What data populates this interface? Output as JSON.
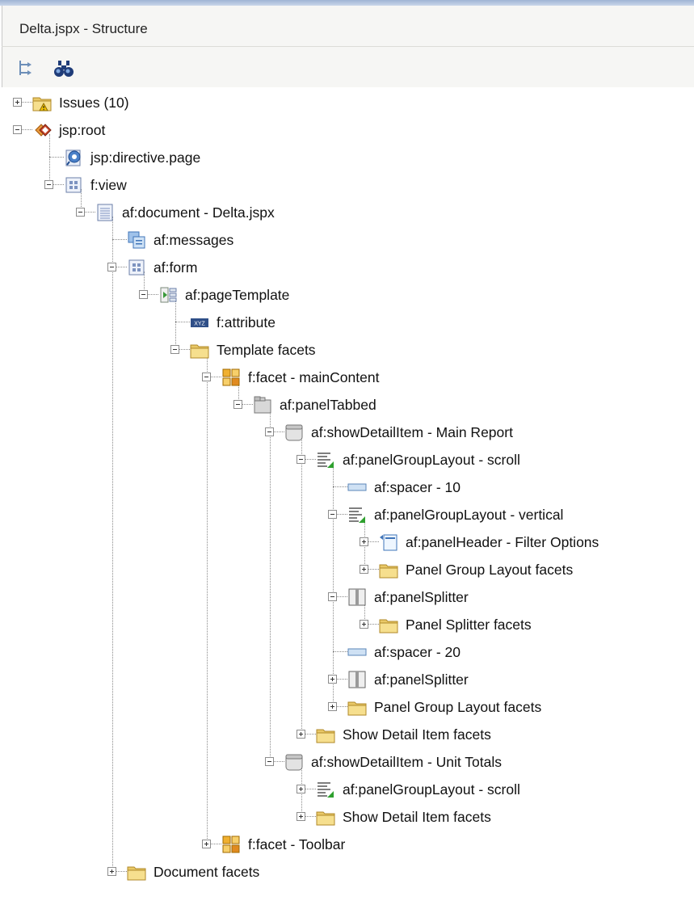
{
  "panel_title": "Delta.jspx - Structure",
  "toolbar": [
    {
      "name": "tree-sync-icon"
    },
    {
      "name": "binoculars-icon"
    }
  ],
  "tree": [
    {
      "level": 0,
      "label": "Issues (10)",
      "icon": "folder-warning",
      "expander": "plus"
    },
    {
      "level": 0,
      "label": "jsp:root",
      "icon": "jsp-root",
      "expander": "minus"
    },
    {
      "level": 1,
      "label": "jsp:directive.page",
      "icon": "directive",
      "expander": "none"
    },
    {
      "level": 1,
      "label": "f:view",
      "icon": "grid-box",
      "expander": "minus"
    },
    {
      "level": 2,
      "label": "af:document - Delta.jspx",
      "icon": "document",
      "expander": "minus"
    },
    {
      "level": 3,
      "label": "af:messages",
      "icon": "messages",
      "expander": "none"
    },
    {
      "level": 3,
      "label": "af:form",
      "icon": "grid-box",
      "expander": "minus"
    },
    {
      "level": 4,
      "label": "af:pageTemplate",
      "icon": "page-template",
      "expander": "minus"
    },
    {
      "level": 5,
      "label": "f:attribute",
      "icon": "attribute",
      "expander": "none"
    },
    {
      "level": 5,
      "label": "Template facets",
      "icon": "folder",
      "expander": "minus"
    },
    {
      "level": 6,
      "label": "f:facet - mainContent",
      "icon": "facet",
      "expander": "minus"
    },
    {
      "level": 7,
      "label": "af:panelTabbed",
      "icon": "panel-tabbed",
      "expander": "minus"
    },
    {
      "level": 8,
      "label": "af:showDetailItem - Main Report",
      "icon": "show-detail",
      "expander": "minus"
    },
    {
      "level": 9,
      "label": "af:panelGroupLayout - scroll",
      "icon": "group-layout",
      "expander": "minus"
    },
    {
      "level": 10,
      "label": "af:spacer - 10",
      "icon": "spacer",
      "expander": "none"
    },
    {
      "level": 10,
      "label": "af:panelGroupLayout - vertical",
      "icon": "group-layout",
      "expander": "minus"
    },
    {
      "level": 11,
      "label": "af:panelHeader - Filter Options",
      "icon": "panel-header",
      "expander": "plus"
    },
    {
      "level": 11,
      "label": "Panel Group Layout facets",
      "icon": "folder",
      "expander": "plus"
    },
    {
      "level": 10,
      "label": "af:panelSplitter",
      "icon": "splitter",
      "expander": "minus"
    },
    {
      "level": 11,
      "label": "Panel Splitter facets",
      "icon": "folder",
      "expander": "plus"
    },
    {
      "level": 10,
      "label": "af:spacer - 20",
      "icon": "spacer",
      "expander": "none"
    },
    {
      "level": 10,
      "label": "af:panelSplitter",
      "icon": "splitter",
      "expander": "plus"
    },
    {
      "level": 10,
      "label": "Panel Group Layout facets",
      "icon": "folder",
      "expander": "plus"
    },
    {
      "level": 9,
      "label": "Show Detail Item facets",
      "icon": "folder",
      "expander": "plus"
    },
    {
      "level": 8,
      "label": "af:showDetailItem - Unit Totals",
      "icon": "show-detail",
      "expander": "minus"
    },
    {
      "level": 9,
      "label": "af:panelGroupLayout - scroll",
      "icon": "group-layout",
      "expander": "plus"
    },
    {
      "level": 9,
      "label": "Show Detail Item facets",
      "icon": "folder",
      "expander": "plus"
    },
    {
      "level": 6,
      "label": "f:facet - Toolbar",
      "icon": "facet",
      "expander": "plus"
    },
    {
      "level": 3,
      "label": "Document facets",
      "icon": "folder",
      "expander": "plus"
    }
  ]
}
